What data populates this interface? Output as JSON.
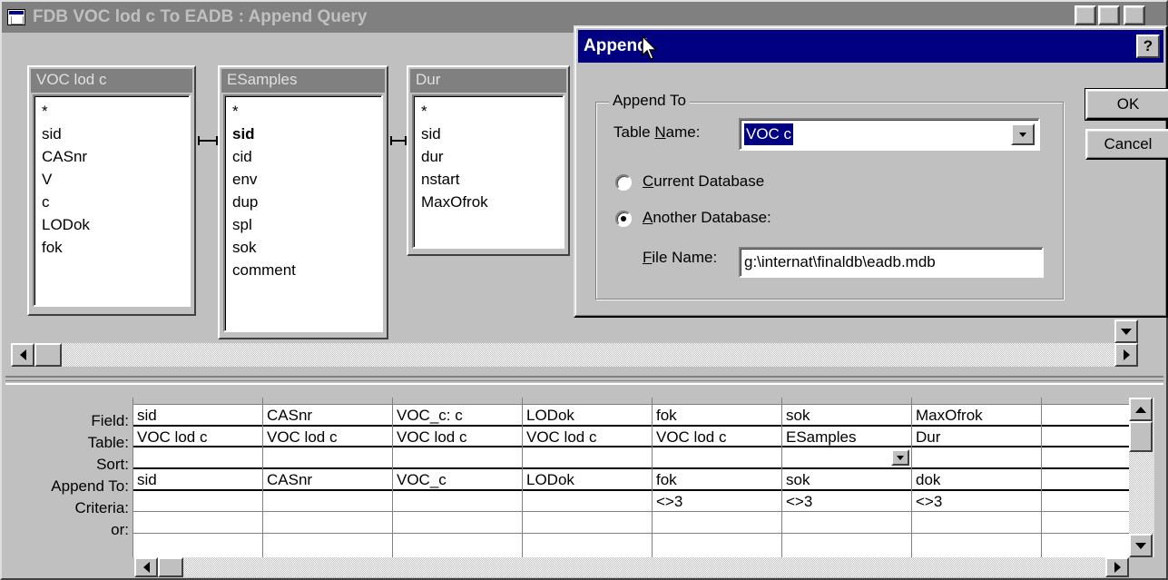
{
  "window": {
    "title": "FDB VOC lod c To EADB : Append Query"
  },
  "tables": [
    {
      "name": "VOC lod c",
      "fields": [
        "*",
        "sid",
        "CASnr",
        "V",
        "c",
        "LODok",
        "fok"
      ]
    },
    {
      "name": "ESamples",
      "fields": [
        "*",
        "sid",
        "cid",
        "env",
        "dup",
        "spl",
        "sok",
        "comment"
      ]
    },
    {
      "name": "Dur",
      "fields": [
        "*",
        "sid",
        "dur",
        "nstart",
        "MaxOfrok"
      ]
    }
  ],
  "grid": {
    "row_labels": [
      "Field:",
      "Table:",
      "Sort:",
      "Append To:",
      "Criteria:",
      "or:"
    ],
    "columns": [
      {
        "field": "sid",
        "table": "VOC lod c",
        "sort": "",
        "append_to": "sid",
        "criteria": "",
        "or": ""
      },
      {
        "field": "CASnr",
        "table": "VOC lod c",
        "sort": "",
        "append_to": "CASnr",
        "criteria": "",
        "or": ""
      },
      {
        "field": "VOC_c: c",
        "table": "VOC lod c",
        "sort": "",
        "append_to": "VOC_c",
        "criteria": "",
        "or": ""
      },
      {
        "field": "LODok",
        "table": "VOC lod c",
        "sort": "",
        "append_to": "LODok",
        "criteria": "",
        "or": ""
      },
      {
        "field": "fok",
        "table": "VOC lod c",
        "sort": "",
        "append_to": "fok",
        "criteria": "<>3",
        "or": ""
      },
      {
        "field": "sok",
        "table": "ESamples",
        "sort": "",
        "append_to": "sok",
        "criteria": "<>3",
        "or": ""
      },
      {
        "field": "MaxOfrok",
        "table": "Dur",
        "sort": "",
        "append_to": "dok",
        "criteria": "<>3",
        "or": ""
      },
      {
        "field": "",
        "table": "",
        "sort": "",
        "append_to": "",
        "criteria": "",
        "or": ""
      }
    ]
  },
  "dialog": {
    "title": "Append",
    "help": "?",
    "group_label": "Append To",
    "table_name_pre": "Table ",
    "table_name_u": "N",
    "table_name_post": "ame:",
    "table_name_value": "VOC c",
    "current_db_u": "C",
    "current_db_post": "urrent Database",
    "another_db_u": "A",
    "another_db_post": "nother Database:",
    "file_name_u": "F",
    "file_name_post": "ile Name:",
    "file_name_value": "g:\\internat\\finaldb\\eadb.mdb",
    "ok": "OK",
    "cancel": "Cancel",
    "selected_option": "another"
  },
  "colors": {
    "active_title": "#000080",
    "inactive_title": "#808080",
    "face": "#c0c0c0"
  },
  "icons": [
    "app-icon",
    "help-icon",
    "mouse-cursor-icon",
    "scroll-left-icon",
    "scroll-right-icon",
    "scroll-up-icon",
    "scroll-down-icon",
    "dropdown-arrow-icon"
  ]
}
